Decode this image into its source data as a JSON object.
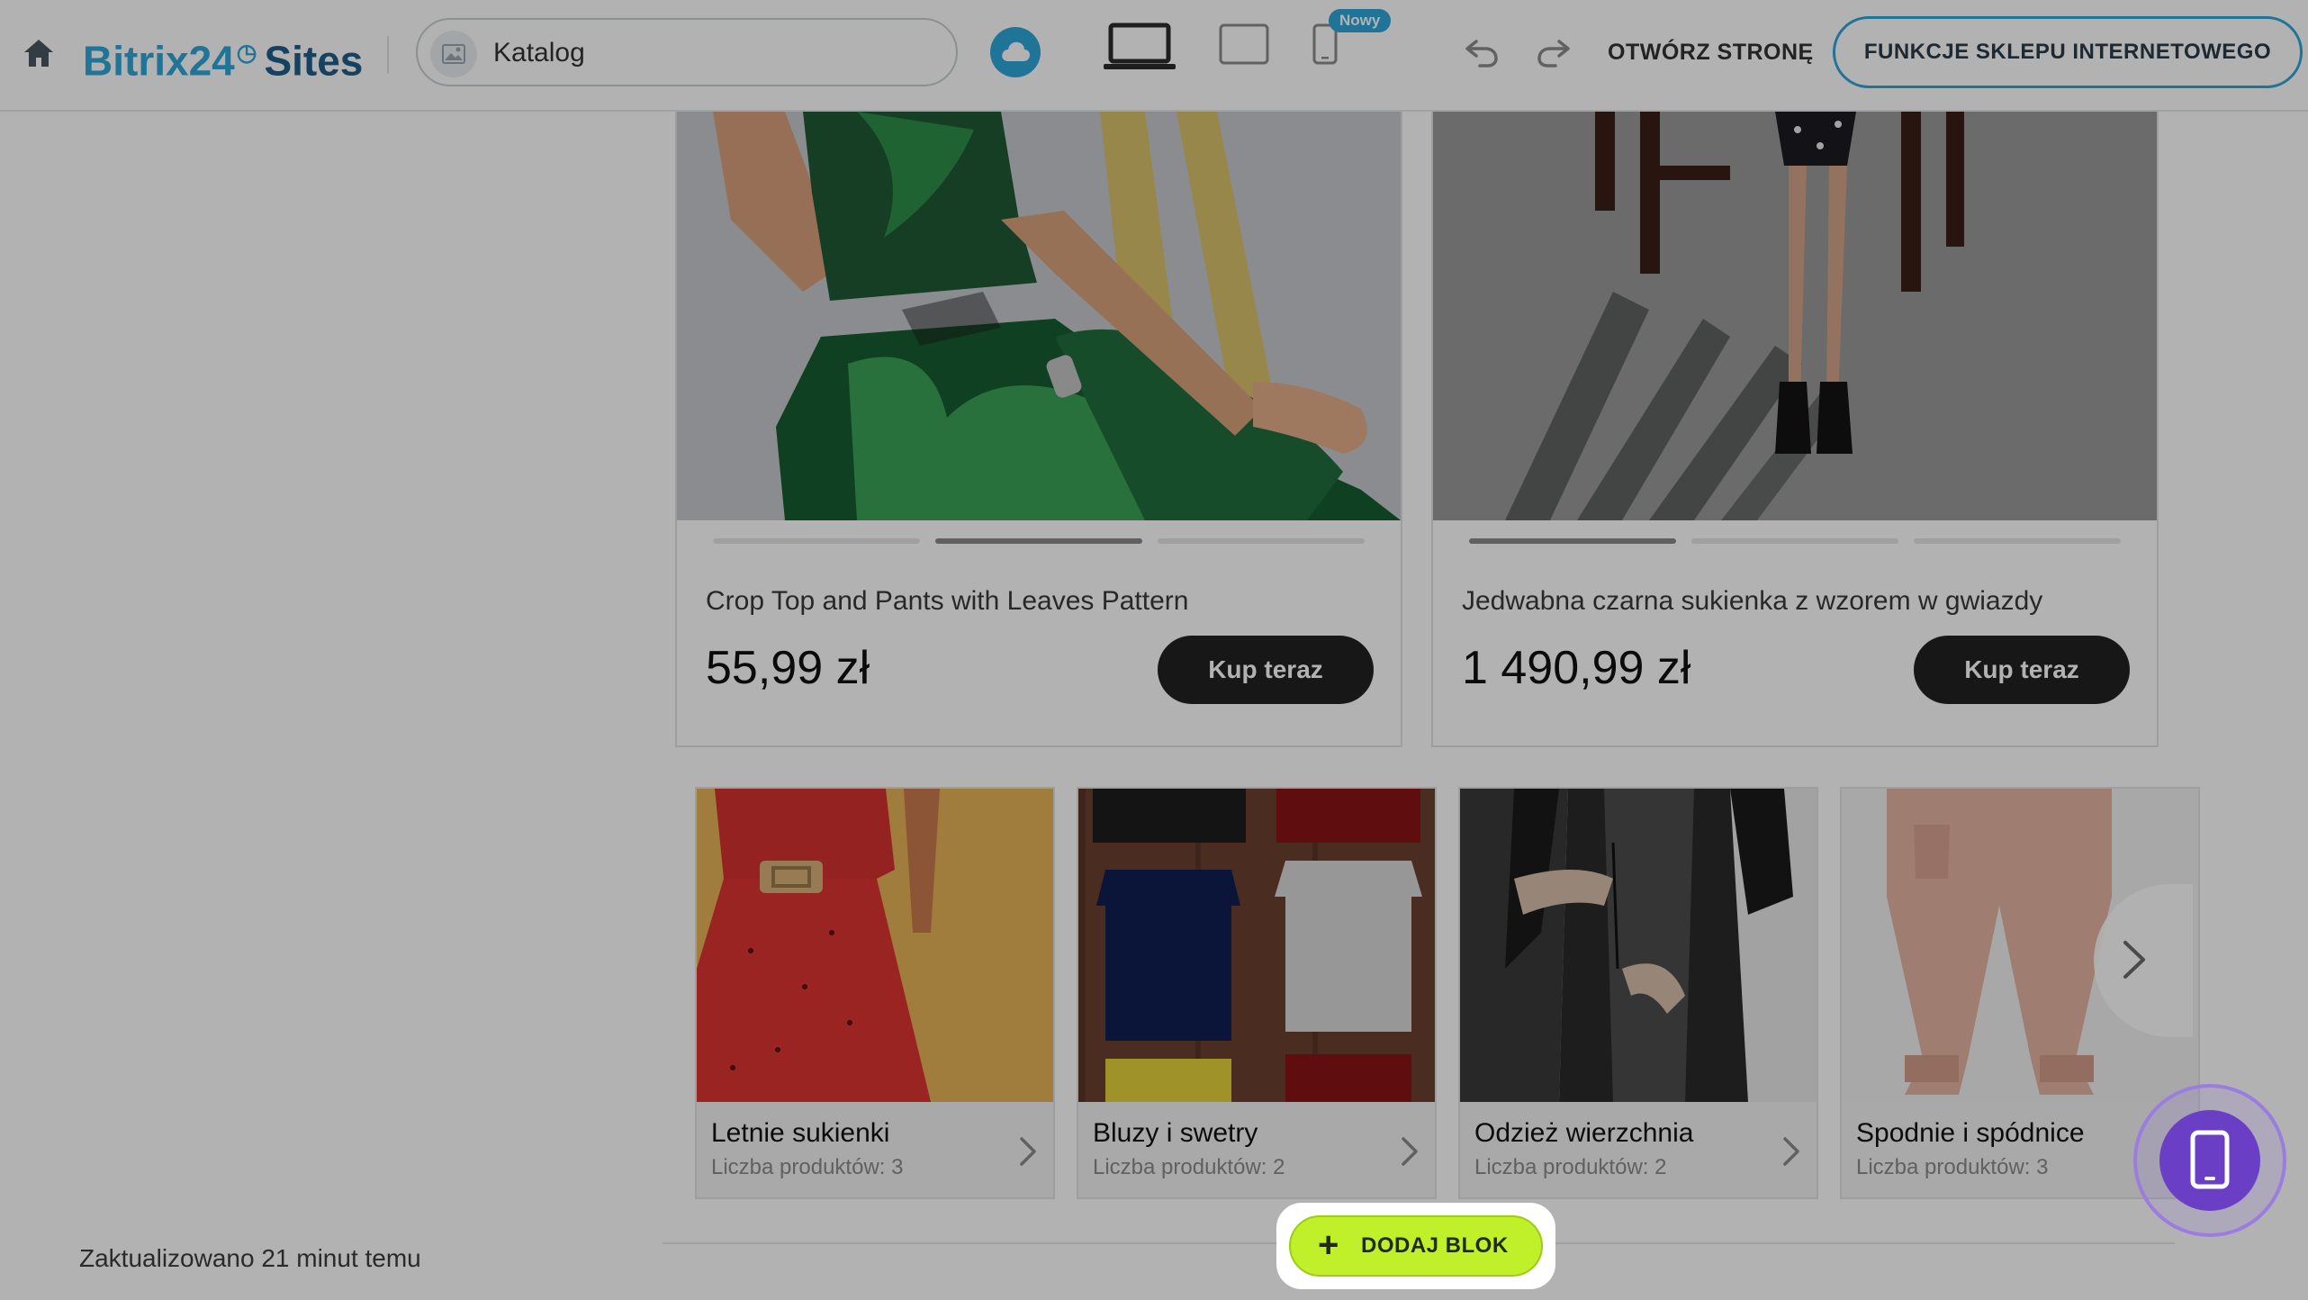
{
  "toolbar": {
    "logo_main": "Bitrix24",
    "logo_sub": "Sites",
    "page_selector": "Katalog",
    "new_badge": "Nowy",
    "open_page": "OTWÓRZ STRONĘ",
    "shop_features": "FUNKCJE SKLEPU INTERNETOWEGO",
    "icons": [
      "home-icon",
      "cloud-icon",
      "desktop-icon",
      "tablet-icon",
      "mobile-icon",
      "undo-icon",
      "redo-icon"
    ]
  },
  "products": [
    {
      "title": "Crop Top and Pants with Leaves Pattern",
      "price": "55,99 zł",
      "buy": "Kup teraz",
      "slide_count": 3,
      "active_slide": 2
    },
    {
      "title": "Jedwabna czarna sukienka z wzorem w gwiazdy",
      "price": "1 490,99 zł",
      "buy": "Kup teraz",
      "slide_count": 3,
      "active_slide": 1
    }
  ],
  "categories": [
    {
      "name": "Letnie sukienki",
      "count": "Liczba produktów: 3"
    },
    {
      "name": "Bluzy i swetry",
      "count": "Liczba produktów: 2"
    },
    {
      "name": "Odzież wierzchnia",
      "count": "Liczba produktów: 2"
    },
    {
      "name": "Spodnie i spódnice",
      "count": "Liczba produktów: 3"
    }
  ],
  "footer": {
    "status": "Zaktualizowano 21 minut temu",
    "add_block": "DODAJ BLOK"
  },
  "colors": {
    "accent_blue": "#2fa6d8",
    "logo_dark": "#1f5f8c",
    "add_block_green": "#bff02a",
    "preview_purple": "#6a3fc6",
    "overlay": "rgba(0,0,0,0.30)"
  }
}
